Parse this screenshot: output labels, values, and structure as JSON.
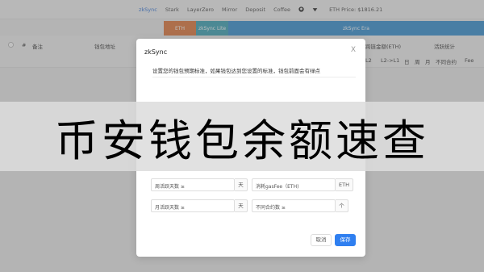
{
  "nav": {
    "items": [
      "zkSync",
      "Stark",
      "LayerZero",
      "Mirror",
      "Deposit",
      "Coffee"
    ],
    "price": "ETH Price: $1816.21"
  },
  "subheader": {
    "eth": "ETH",
    "lite": "zkSync Lite",
    "era": "zkSync Era"
  },
  "table": {
    "hash": "#",
    "remark": "备注",
    "address": "钱包地址",
    "amount_col": "跨链金额(ETH)",
    "active_stats": "活跃统计",
    "l2": "L2",
    "l2_l1": "L2->L1",
    "day": "日",
    "week": "周",
    "month": "月",
    "contracts": "不同合约",
    "fee": "Fee"
  },
  "modal": {
    "title": "zkSync",
    "close": "X",
    "description": "设置您的钱包预期标准，如果钱包达到您设置的标准，钱包前面会有绿点",
    "fields": [
      {
        "label": "周活跃天数 ≥",
        "suffix": "天"
      },
      {
        "label": "消耗gasFee（ETH)",
        "suffix": "ETH"
      },
      {
        "label": "月活跃天数 ≥",
        "suffix": "天"
      },
      {
        "label": "不同合约数 ≥",
        "suffix": "个"
      }
    ],
    "cancel": "取消",
    "save": "保存"
  },
  "banner": {
    "text": "币安钱包余额速查"
  }
}
